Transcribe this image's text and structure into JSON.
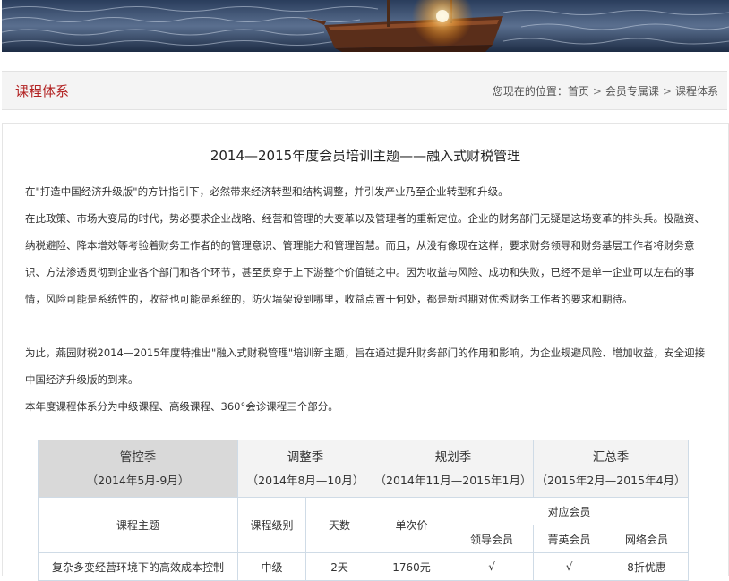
{
  "banner": {
    "icon": "sailing-ship-banner"
  },
  "header": {
    "section_title": "课程体系",
    "breadcrumb_prefix": "您现在的位置：",
    "breadcrumb": [
      "首页",
      "会员专属课",
      "课程体系"
    ],
    "separator": ">"
  },
  "article": {
    "title": "2014—2015年度会员培训主题——融入式财税管理",
    "paragraphs": [
      "在\"打造中国经济升级版\"的方针指引下，必然带来经济转型和结构调整，并引发产业乃至企业转型和升级。",
      "在此政策、市场大变局的时代，势必要求企业战略、经营和管理的大变革以及管理者的重新定位。企业的财务部门无疑是这场变革的排头兵。投融资、纳税避险、降本增效等考验着财务工作者的的管理意识、管理能力和管理智慧。而且，从没有像现在这样，要求财务领导和财务基层工作者将财务意识、方法渗透贯彻到企业各个部门和各个环节，甚至贯穿于上下游整个价值链之中。因为收益与风险、成功和失败，已经不是单一企业可以左右的事情，风险可能是系统性的，收益也可能是系统的，防火墙架设到哪里，收益点置于何处，都是新时期对优秀财务工作者的要求和期待。",
      "为此，燕园财税2014—2015年度特推出\"融入式财税管理\"培训新主题，旨在通过提升财务部门的作用和影响，为企业规避风险、增加收益，安全迎接中国经济升级版的到来。",
      "本年度课程体系分为中级课程、高级课程、360°会诊课程三个部分。"
    ]
  },
  "seasons": [
    {
      "name": "管控季",
      "range": "（2014年5月-9月）"
    },
    {
      "name": "调整季",
      "range": "（2014年8月—10月）"
    },
    {
      "name": "规划季",
      "range": "（2014年11月—2015年1月）"
    },
    {
      "name": "汇总季",
      "range": "（2015年2月—2015年4月）"
    }
  ],
  "table": {
    "headers": {
      "topic": "课程主题",
      "level": "课程级别",
      "days": "天数",
      "price": "单次价",
      "members": "对应会员",
      "leader": "领导会员",
      "elite": "菁英会员",
      "online": "网络会员"
    },
    "rows": [
      {
        "topic": "复杂多变经营环境下的高效成本控制",
        "level": "中级",
        "days": "2天",
        "price": "1760元",
        "leader": "√",
        "elite": "√",
        "online": "8折优惠"
      }
    ]
  }
}
